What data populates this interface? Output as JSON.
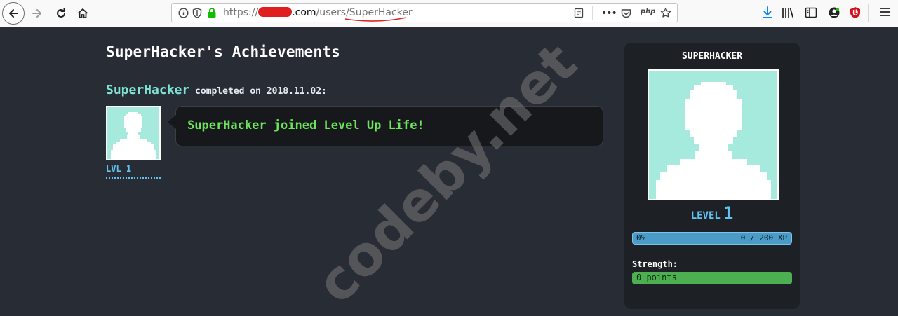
{
  "browser": {
    "url": {
      "scheme": "https://",
      "domain_suffix": ".com",
      "path": "/users/SuperHacker"
    },
    "icons": [
      "back-icon",
      "forward-icon",
      "reload-icon",
      "home-icon",
      "info-icon",
      "tracking-shield-icon",
      "lock-icon",
      "reader-view-icon",
      "more-icon",
      "pocket-icon",
      "php-addon-icon",
      "bookmark-star-icon",
      "download-icon",
      "library-icon",
      "sidebar-icon",
      "account-icon",
      "ublock-icon",
      "menu-icon"
    ],
    "php_label": "php"
  },
  "page": {
    "title": "SuperHacker's Achievements",
    "entry": {
      "username": "SuperHacker",
      "completed_text": "completed on 2018.11.02:",
      "level_label": "LVL 1",
      "message": "SuperHacker joined Level Up Life!"
    }
  },
  "profile": {
    "name": "SUPERHACKER",
    "level_label": "LEVEL",
    "level_value": "1",
    "xp_percent_label": "0%",
    "xp_progress": 0,
    "xp_text": "0 / 200 XP",
    "strength_label": "Strength:",
    "strength_value": "0 points"
  },
  "watermark": "codeby.net",
  "colors": {
    "background": "#282c34",
    "accent_teal": "#7fe3d4",
    "accent_blue": "#62c3f3",
    "message_green": "#6ee45c",
    "strength_green": "#4caf50",
    "avatar_bg": "#a5eadc"
  }
}
